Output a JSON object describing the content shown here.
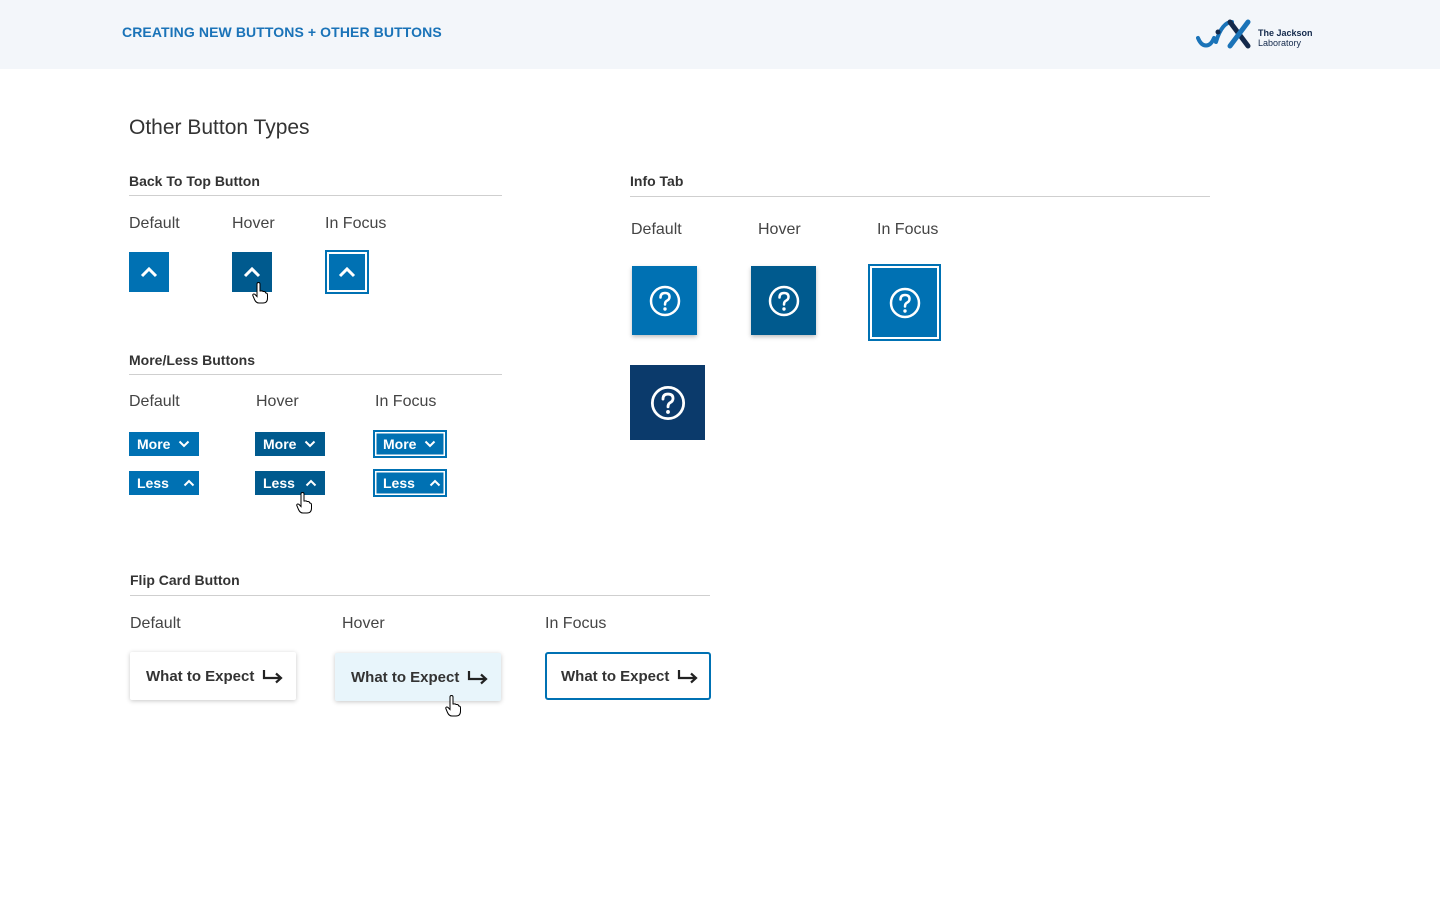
{
  "header": {
    "title": "CREATING NEW BUTTONS + OTHER BUTTONS",
    "logo_line1": "The Jackson",
    "logo_line2": "Laboratory"
  },
  "page_title": "Other Button Types",
  "states": {
    "default": "Default",
    "hover": "Hover",
    "focus": "In Focus"
  },
  "back_to_top": {
    "title": "Back To Top Button",
    "icon": "chevron-up-icon"
  },
  "more_less": {
    "title": "More/Less Buttons",
    "more": "More",
    "less": "Less"
  },
  "info_tab": {
    "title": "Info Tab",
    "icon": "question-circle-icon"
  },
  "flip_card": {
    "title": "Flip Card Button",
    "label": "What to Expect",
    "icon": "arrow-return-right-icon"
  },
  "colors": {
    "primary": "#0071b3",
    "hover": "#005a8e",
    "active": "#0b3a6b",
    "header_bg": "#f3f6fa",
    "header_text": "#1a73b8",
    "flip_hover_bg": "#e8f5fb"
  }
}
